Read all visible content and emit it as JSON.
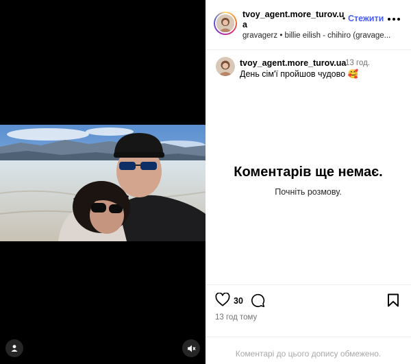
{
  "post": {
    "username": "tvoy_agent.more_turov.ua",
    "follow_label": "Стежити",
    "dot": "•",
    "audio": "gravagerz • billie eilish - chihiro (gravage...",
    "caption": {
      "username": "tvoy_agent.more_turov.ua",
      "time": "13 год.",
      "text": "День сім'ї пройшов чудово 🥰"
    },
    "comments_empty": {
      "title": "Коментарів ще немає.",
      "subtitle": "Почніть розмову."
    },
    "likes": "30",
    "timestamp": "13 год тому",
    "comments_limited": "Коментарі до цього допису обмежено."
  },
  "icons": {
    "more": "more-horizontal-icon",
    "like": "heart-icon",
    "comment": "comment-icon",
    "save": "bookmark-icon",
    "user_tag": "user-tag-icon",
    "mute": "speaker-muted-icon"
  },
  "colors": {
    "follow": "#4a5df9",
    "secondary_text": "#737373",
    "media_background": "#000000"
  }
}
